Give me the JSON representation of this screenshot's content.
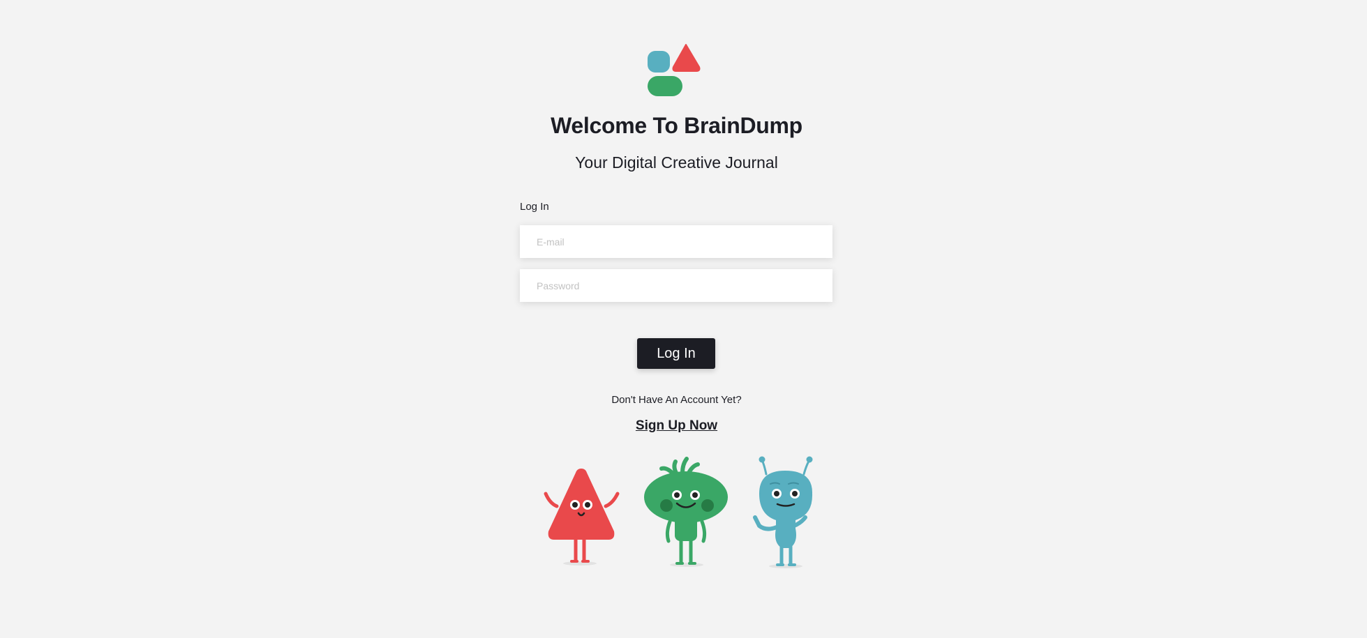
{
  "app": {
    "title": "Welcome To BrainDump",
    "subtitle": "Your Digital Creative Journal"
  },
  "logo": {
    "icon": "braindump-logo-icon",
    "colors": {
      "teal": "#58afc0",
      "red": "#e9494b",
      "green": "#3aa766"
    }
  },
  "login_form": {
    "section_label": "Log In",
    "email_placeholder": "E-mail",
    "password_placeholder": "Password",
    "submit_label": "Log In"
  },
  "signup": {
    "prompt": "Don't Have An Account Yet?",
    "link_label": "Sign Up Now"
  },
  "illustration": {
    "characters": [
      "red-triangle-mascot-icon",
      "green-blob-mascot-icon",
      "teal-alien-mascot-icon"
    ]
  },
  "colors": {
    "background": "#f3f3f3",
    "primary_dark": "#1c1d24"
  }
}
